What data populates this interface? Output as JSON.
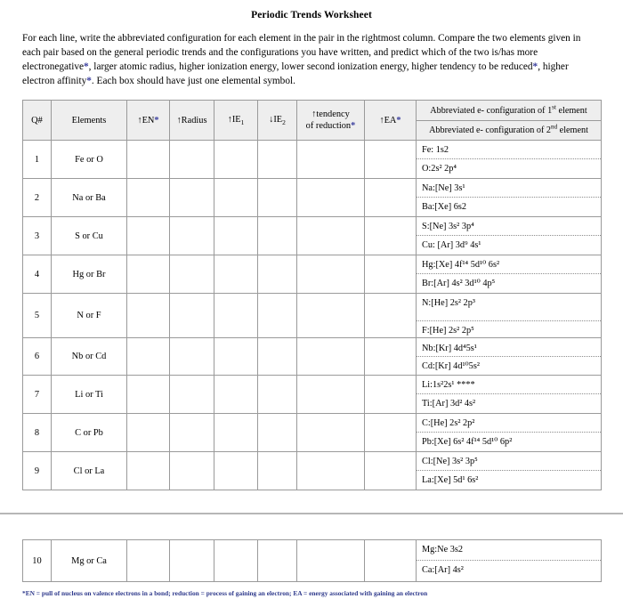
{
  "document": {
    "title": "Periodic Trends Worksheet",
    "intro": "For each line, write the abbreviated configuration for each element in the pair in the rightmost column. Compare the two elements given in each pair based on the general periodic trends and the configurations you have written, and predict which of the two is/has more electronegative*, larger atomic radius, higher ionization energy, lower second ionization energy, higher tendency to be reduced*, higher electron affinity*. Each box should have just one elemental symbol.",
    "footnote": "*EN = pull of nucleus on valence electrons in a bond; reduction = process of gaining an electron; EA = energy associated with gaining an electron",
    "accent_color": "#3b3f9e",
    "header_fill": "#eeeeee",
    "border_color": "#9a9a9a"
  },
  "table": {
    "headers": {
      "qnum": "Q#",
      "elements": "Elements",
      "en": "↑EN",
      "radius": "↑Radius",
      "ie1": "↑IE",
      "ie1_sub": "1",
      "ie2": "↓IE",
      "ie2_sub": "2",
      "tendency_line1": "↑tendency",
      "tendency_line2": "of reduction",
      "ea": "↑EA",
      "config_first": "Abbreviated e- configuration of 1",
      "config_first_sup": "st",
      "config_first_tail": " element",
      "config_second": "Abbreviated e- configuration of 2",
      "config_second_sup": "nd",
      "config_second_tail": " element"
    },
    "rows": [
      {
        "q": "1",
        "elements": "Fe or O",
        "cfg1": "Fe: 1s2",
        "cfg2": "O:2s² 2p⁴"
      },
      {
        "q": "2",
        "elements": "Na or Ba",
        "cfg1": "Na:[Ne] 3s¹",
        "cfg2": "Ba:[Xe] 6s2"
      },
      {
        "q": "3",
        "elements": "S or Cu",
        "cfg1": "S:[Ne] 3s² 3p⁴",
        "cfg2": "Cu: [Ar] 3d⁹ 4s¹"
      },
      {
        "q": "4",
        "elements": "Hg or Br",
        "cfg1": "Hg:[Xe] 4f¹⁴ 5d¹⁰ 6s²",
        "cfg2": "Br:[Ar] 4s² 3d¹⁰ 4p⁵"
      },
      {
        "q": "5",
        "elements": "N or F",
        "cfg1": "N:[He] 2s² 2p³",
        "cfg2": "F:[He] 2s² 2p⁵"
      },
      {
        "q": "6",
        "elements": "Nb or Cd",
        "cfg1": "Nb:[Kr] 4d⁴5s¹",
        "cfg2": "Cd:[Kr] 4d¹⁰5s²"
      },
      {
        "q": "7",
        "elements": "Li or Ti",
        "cfg1": "Li:1s²2s¹ ****",
        "cfg2": "Ti:[Ar] 3d² 4s²"
      },
      {
        "q": "8",
        "elements": "C or Pb",
        "cfg1": "C:[He] 2s² 2p²",
        "cfg2": "Pb:[Xe] 6s² 4f¹⁴ 5d¹⁰ 6p²"
      },
      {
        "q": "9",
        "elements": "Cl or La",
        "cfg1": "Cl:[Ne] 3s² 3p⁵",
        "cfg2": "La:[Xe] 5d¹ 6s²"
      }
    ],
    "continuation_rows": [
      {
        "q": "10",
        "elements": "Mg or Ca",
        "cfg1": "Mg:Ne 3s2",
        "cfg2": "Ca:[Ar] 4s²"
      }
    ]
  }
}
